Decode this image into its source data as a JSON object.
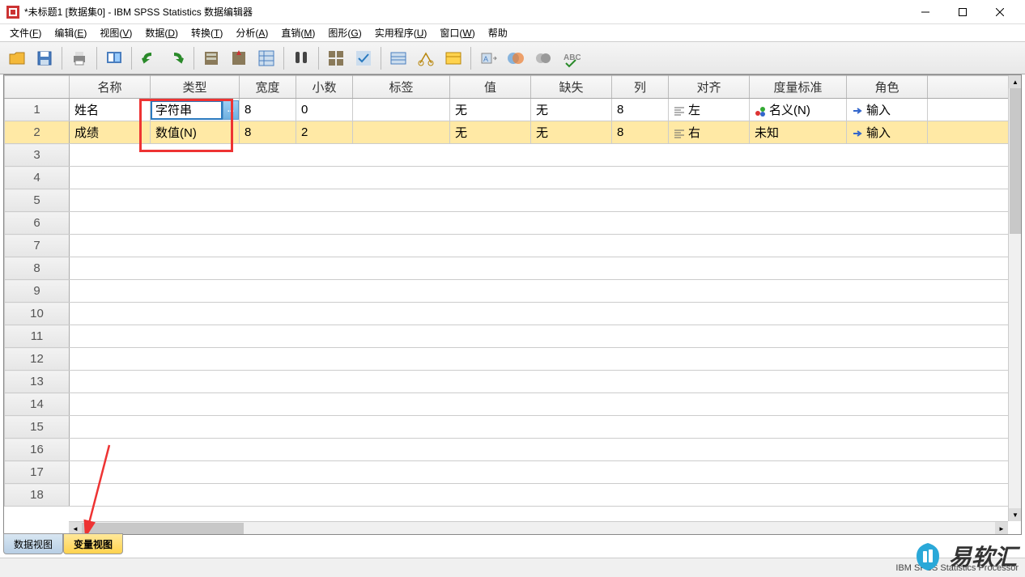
{
  "window": {
    "title": "*未标题1 [数据集0] - IBM SPSS Statistics 数据编辑器"
  },
  "menu": {
    "items": [
      {
        "label": "文件",
        "u": "F"
      },
      {
        "label": "编辑",
        "u": "E"
      },
      {
        "label": "视图",
        "u": "V"
      },
      {
        "label": "数据",
        "u": "D"
      },
      {
        "label": "转换",
        "u": "T"
      },
      {
        "label": "分析",
        "u": "A"
      },
      {
        "label": "直销",
        "u": "M"
      },
      {
        "label": "图形",
        "u": "G"
      },
      {
        "label": "实用程序",
        "u": "U"
      },
      {
        "label": "窗口",
        "u": "W"
      },
      {
        "label": "帮助",
        "u": ""
      }
    ]
  },
  "columns": [
    "名称",
    "类型",
    "宽度",
    "小数",
    "标签",
    "值",
    "缺失",
    "列",
    "对齐",
    "度量标准",
    "角色"
  ],
  "rows": [
    {
      "n": "1",
      "name": "姓名",
      "type": "字符串",
      "width": "8",
      "dec": "0",
      "label": "",
      "value": "无",
      "missing": "无",
      "cols": "8",
      "align": "左",
      "measure": "名义(N)",
      "role": "输入",
      "editing": true
    },
    {
      "n": "2",
      "name": "成绩",
      "type": "数值(N)",
      "width": "8",
      "dec": "2",
      "label": "",
      "value": "无",
      "missing": "无",
      "cols": "8",
      "align": "右",
      "measure": "未知",
      "role": "输入",
      "selected": true
    }
  ],
  "emptyRows": [
    "3",
    "4",
    "5",
    "6",
    "7",
    "8",
    "9",
    "10",
    "11",
    "12",
    "13",
    "14",
    "15",
    "16",
    "17",
    "18"
  ],
  "tabs": {
    "data": "数据视图",
    "var": "变量视图"
  },
  "status": "IBM SPSS Statistics Processor",
  "watermark": "易软汇",
  "cell_edit_btn": "..."
}
